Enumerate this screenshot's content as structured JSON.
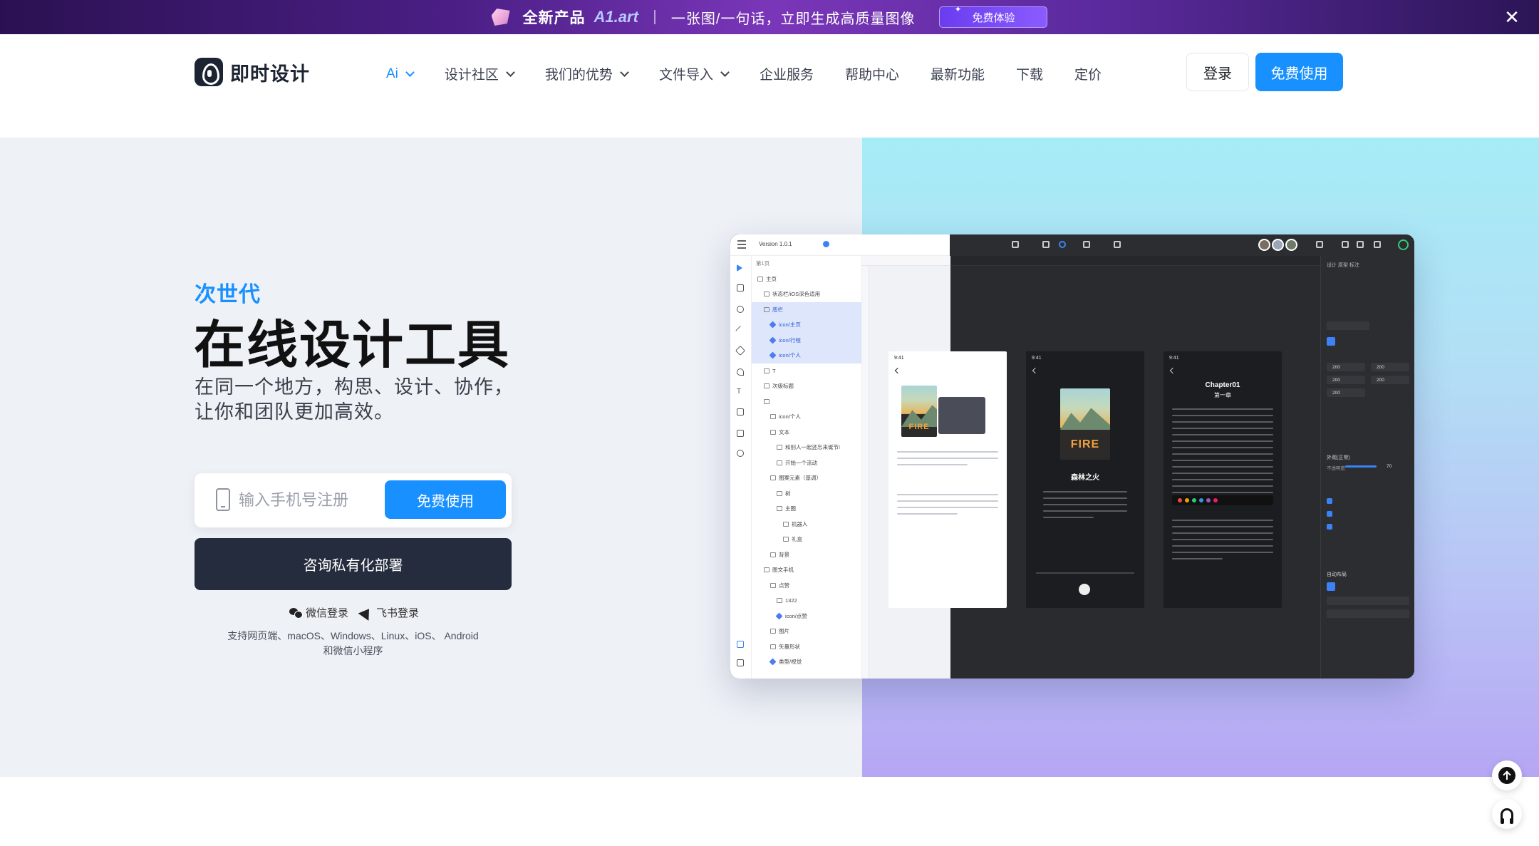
{
  "banner": {
    "product_label": "全新产品",
    "brand": "A1.art",
    "slogan": "一张图/一句话，立即生成高质量图像",
    "cta": "免费体验"
  },
  "header": {
    "logo_text": "即时设计",
    "nav": [
      {
        "label": "Ai",
        "dropdown": true,
        "active": true
      },
      {
        "label": "设计社区",
        "dropdown": true
      },
      {
        "label": "我们的优势",
        "dropdown": true
      },
      {
        "label": "文件导入",
        "dropdown": true
      },
      {
        "label": "企业服务",
        "dropdown": false
      },
      {
        "label": "帮助中心",
        "dropdown": false
      },
      {
        "label": "最新功能",
        "dropdown": false
      },
      {
        "label": "下载",
        "dropdown": false
      },
      {
        "label": "定价",
        "dropdown": false
      }
    ],
    "login_label": "登录",
    "free_label": "免费使用"
  },
  "hero": {
    "eyebrow": "次世代",
    "headline": "在线设计工具",
    "sub_line1": "在同一个地方，构思、设计、协作，",
    "sub_line2": "让你和团队更加高效。",
    "phone_placeholder": "输入手机号注册",
    "signup_button": "免费使用",
    "consult_button": "咨询私有化部署",
    "wechat_login": "微信登录",
    "lark_login": "飞书登录",
    "platforms_line1": "支持网页端、macOS、Windows、Linux、iOS、 Android",
    "platforms_line2": "和微信小程序"
  },
  "mockup": {
    "version": "Version 1.0.1",
    "page": "第1页",
    "layers": [
      {
        "label": "主页",
        "sel": false,
        "comp": false,
        "indent": 0
      },
      {
        "label": "状态栏/iOS深色适用",
        "sel": false,
        "comp": false,
        "indent": 1
      },
      {
        "label": "底栏",
        "sel": true,
        "comp": false,
        "indent": 1
      },
      {
        "label": "icon/主页",
        "sel": true,
        "comp": true,
        "indent": 2
      },
      {
        "label": "icon/行程",
        "sel": true,
        "comp": true,
        "indent": 2
      },
      {
        "label": "icon/个人",
        "sel": true,
        "comp": true,
        "indent": 2
      },
      {
        "label": "T",
        "sel": false,
        "comp": false,
        "indent": 1
      },
      {
        "label": "次级标题",
        "sel": false,
        "comp": false,
        "indent": 1
      },
      {
        "label": "",
        "sel": false,
        "comp": false,
        "indent": 1
      },
      {
        "label": "icon/个人",
        "sel": false,
        "comp": false,
        "indent": 2
      },
      {
        "label": "文本",
        "sel": false,
        "comp": false,
        "indent": 2
      },
      {
        "label": "和别人一起还忘来诞节!",
        "sel": false,
        "comp": false,
        "indent": 3
      },
      {
        "label": "开始一个流动",
        "sel": false,
        "comp": false,
        "indent": 3
      },
      {
        "label": "图案元素（基调）",
        "sel": false,
        "comp": false,
        "indent": 2
      },
      {
        "label": "树",
        "sel": false,
        "comp": false,
        "indent": 3
      },
      {
        "label": "主图",
        "sel": false,
        "comp": false,
        "indent": 3
      },
      {
        "label": "机器人",
        "sel": false,
        "comp": false,
        "indent": 4
      },
      {
        "label": "礼盒",
        "sel": false,
        "comp": false,
        "indent": 4
      },
      {
        "label": "背景",
        "sel": false,
        "comp": false,
        "indent": 2
      },
      {
        "label": "图文手机",
        "sel": false,
        "comp": false,
        "indent": 1
      },
      {
        "label": "点赞",
        "sel": false,
        "comp": false,
        "indent": 2
      },
      {
        "label": "1322",
        "sel": false,
        "comp": false,
        "indent": 3
      },
      {
        "label": "icon/点赞",
        "sel": false,
        "comp": true,
        "indent": 3
      },
      {
        "label": "图片",
        "sel": false,
        "comp": false,
        "indent": 2
      },
      {
        "label": "矢量形状",
        "sel": false,
        "comp": false,
        "indent": 2
      },
      {
        "label": "类型/视觉",
        "sel": false,
        "comp": true,
        "indent": 2
      }
    ],
    "book_title": "森林之火",
    "cover_word": "FIRE",
    "chapter": "Chapter01",
    "chapter_sub": "第一章",
    "panel_tabs": "设计   原型   标注",
    "auto_layout": "自动布局",
    "fill_label": "外观(正常)",
    "opacity_label": "不透明度",
    "opacity_value": "70",
    "field_values": [
      "200",
      "200",
      "200",
      "200",
      "200"
    ]
  },
  "colors": {
    "accent": "#1890ff",
    "dark_button": "#242c3d",
    "hero_bg": "#eef1f6"
  },
  "icons": [
    "gem-icon",
    "close-icon",
    "logo-icon",
    "chevron-down-icon",
    "phone-icon",
    "wechat-icon",
    "lark-icon",
    "back-to-top-icon",
    "headset-icon"
  ]
}
